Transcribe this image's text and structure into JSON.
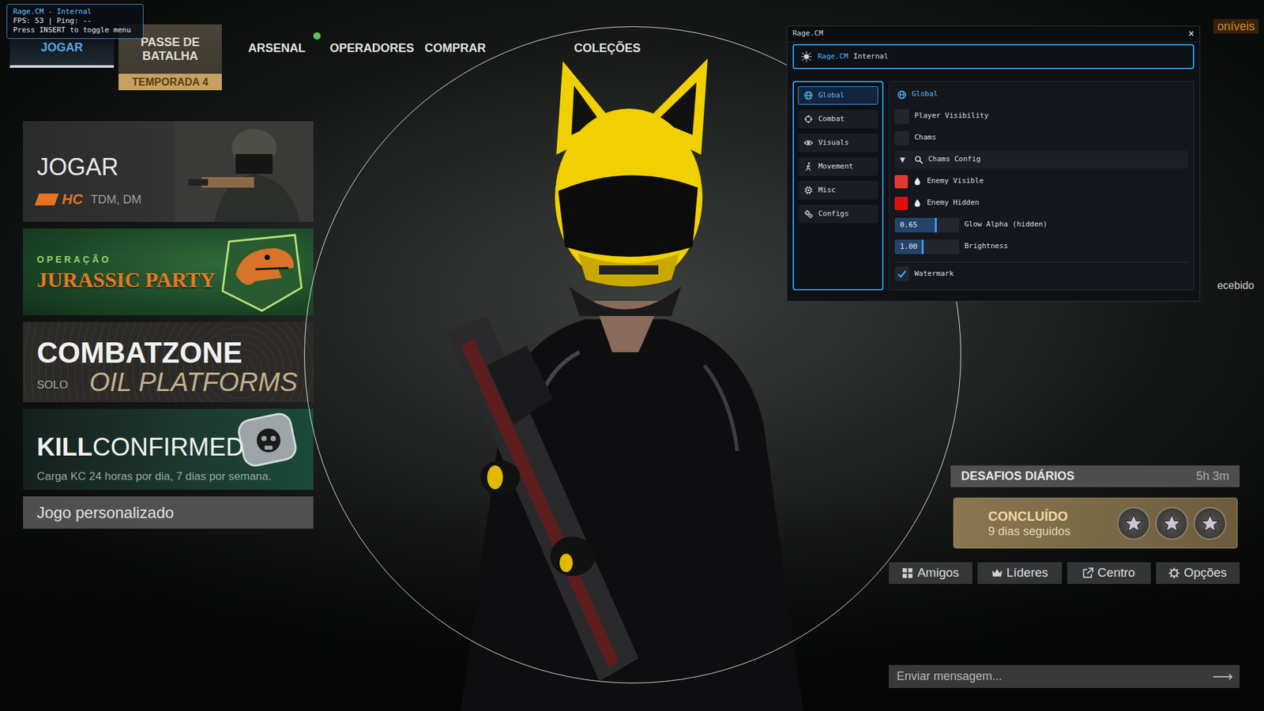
{
  "hud": {
    "title": "Rage.CM - Internal",
    "stats": "FPS: 53 | Ping: --",
    "hint": "Press INSERT to toggle menu"
  },
  "nav": {
    "tabs": [
      {
        "label": "JOGAR",
        "kind": "tab",
        "selected": true,
        "dot": false
      },
      {
        "label": "PASSE DE BATALHA",
        "sub": "TEMPORADA 4",
        "kind": "pass",
        "selected": false,
        "dot": false
      },
      {
        "label": "ARSENAL",
        "kind": "tab",
        "selected": false,
        "dot": true
      },
      {
        "label": "OPERADORES",
        "kind": "tab",
        "selected": false,
        "dot": false
      },
      {
        "label": "COMPRAR",
        "kind": "tab",
        "selected": false,
        "dot": false
      },
      {
        "label": "COLEÇÕES",
        "kind": "tab",
        "selected": false,
        "dot": false
      }
    ],
    "tokens": "oníveis"
  },
  "modes": [
    {
      "kind": "jogar",
      "title": "JOGAR",
      "logo": "HC",
      "detail": "TDM, DM"
    },
    {
      "kind": "operation",
      "kicker": "OPERAÇÃO",
      "title": "JURASSIC PARTY"
    },
    {
      "kind": "combat",
      "title": "COMBATZONE",
      "subtitle": "OIL PLATFORMS",
      "detail": "SOLO"
    },
    {
      "kind": "kill",
      "title": "KILL",
      "title2": "CONFIRMED",
      "detail": "Carga KC 24 horas por dia, 7 dias por semana."
    }
  ],
  "custom_game": "Jogo personalizado",
  "side_label": "ecebido",
  "challenges": {
    "title": "DESAFIOS DIÁRIOS",
    "timer": "5h 3m",
    "status": "CONCLUÍDO",
    "streak": "9 dias seguidos",
    "stars": 3
  },
  "social": [
    {
      "label": "Amigos"
    },
    {
      "label": "Líderes"
    },
    {
      "label": "Centro"
    },
    {
      "label": "Opções"
    }
  ],
  "chat": {
    "placeholder": "Enviar mensagem...",
    "send": "⟶"
  },
  "menu": {
    "title": "Rage.CM",
    "close": "×",
    "brand": "Rage.CM",
    "subtitle": "Internal",
    "tabs": [
      {
        "label": "Global",
        "selected": true
      },
      {
        "label": "Combat",
        "selected": false
      },
      {
        "label": "Visuals",
        "selected": false
      },
      {
        "label": "Movement",
        "selected": false
      },
      {
        "label": "Misc",
        "selected": false
      },
      {
        "label": "Configs",
        "selected": false
      }
    ],
    "section": "Global",
    "rows": [
      {
        "kind": "checkbox",
        "label": "Player Visibility",
        "checked": false
      },
      {
        "kind": "checkbox",
        "label": "Chams",
        "checked": false
      },
      {
        "kind": "group",
        "label": "Chams Config",
        "toggle": "▼",
        "expanded": true
      },
      {
        "kind": "color",
        "label": "Enemy Visible",
        "color": "#e53935"
      },
      {
        "kind": "color",
        "label": "Enemy Hidden",
        "color": "#e01010"
      },
      {
        "kind": "slider",
        "label": "Glow Alpha (hidden)",
        "reading": "0.65",
        "level": 0.65
      },
      {
        "kind": "slider",
        "label": "Brightness",
        "reading": "1.00",
        "level": 0.45
      },
      {
        "kind": "checkbox",
        "label": "Watermark",
        "checked": true
      }
    ]
  }
}
